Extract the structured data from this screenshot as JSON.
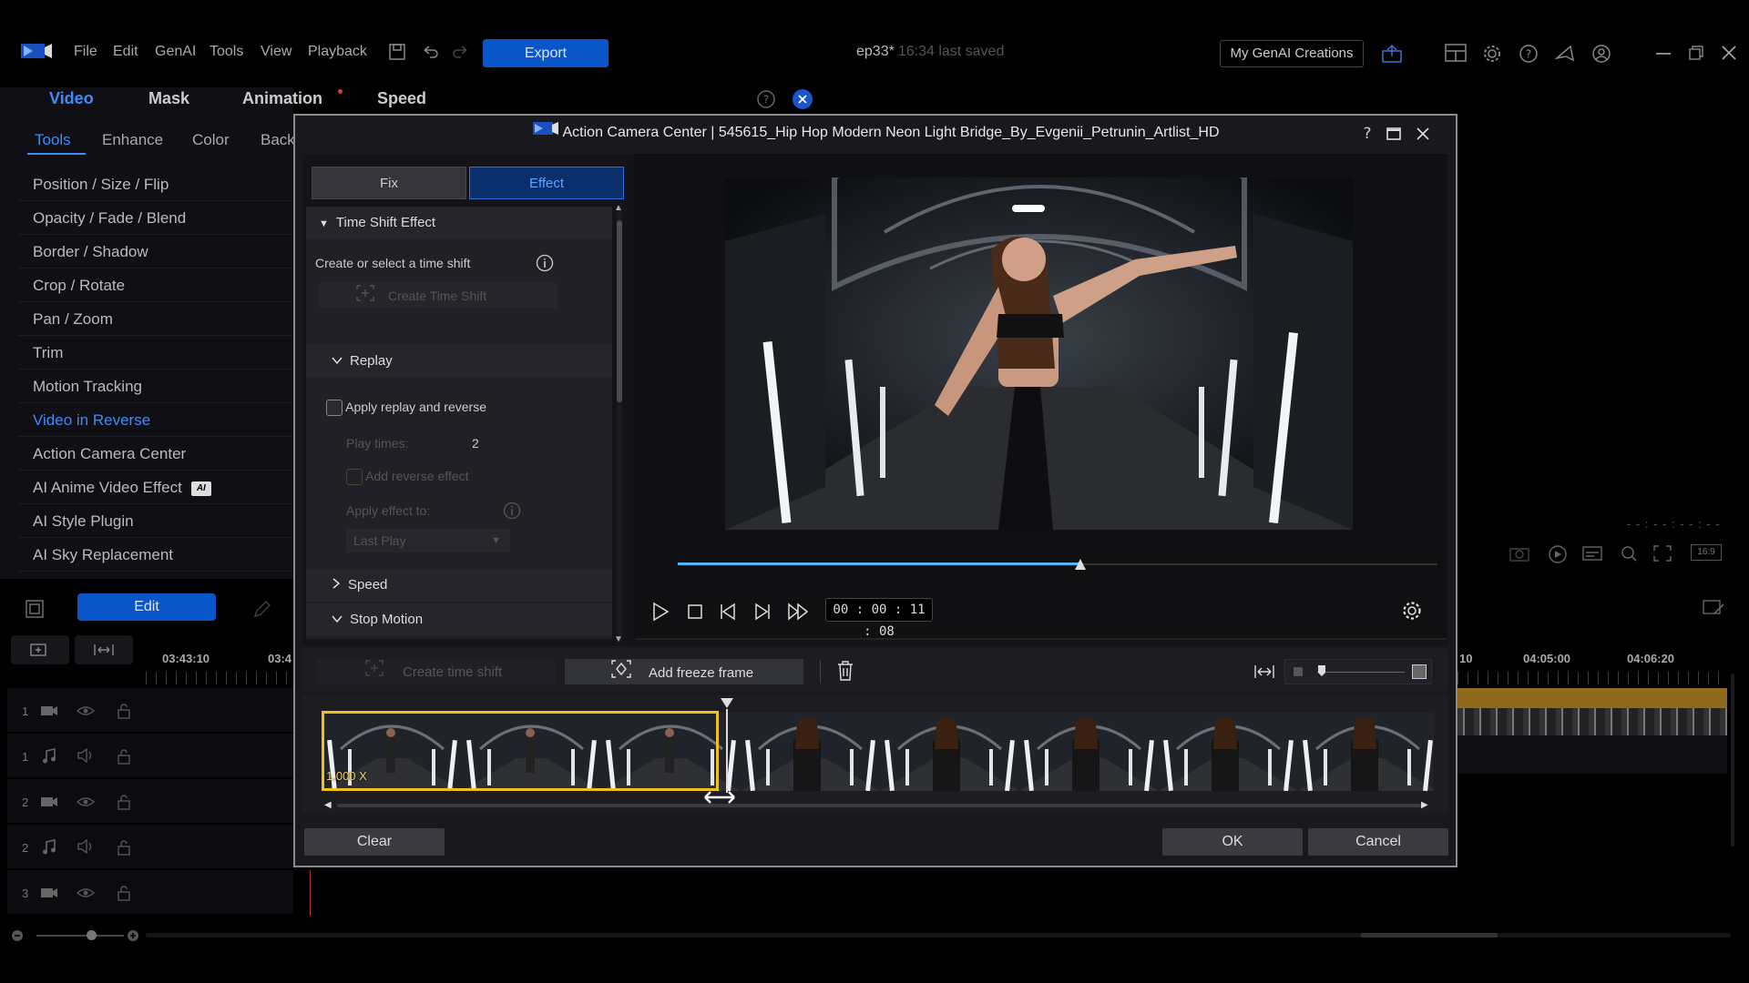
{
  "menu": [
    "File",
    "Edit",
    "GenAI",
    "Tools",
    "View",
    "Playback"
  ],
  "export_label": "Export",
  "project": {
    "name": "ep33*",
    "saved": "16:34 last saved"
  },
  "genai_btn": "My GenAI Creations",
  "main_tabs": [
    "Video",
    "Mask",
    "Animation",
    "Speed"
  ],
  "sub_tabs": [
    "Tools",
    "Enhance",
    "Color",
    "Back"
  ],
  "tools": [
    "Position / Size / Flip",
    "Opacity / Fade / Blend",
    "Border / Shadow",
    "Crop / Rotate",
    "Pan / Zoom",
    "Trim",
    "Motion Tracking",
    "Video in Reverse",
    "Action Camera Center",
    "AI Anime Video Effect",
    "AI Style Plugin",
    "AI Sky Replacement"
  ],
  "ai_badge": "AI",
  "edit_label": "Edit",
  "timeline_left": {
    "t1": "03:43:10",
    "t2": "03:4"
  },
  "timeline_right": {
    "t1": "10",
    "t2": "04:05:00",
    "t3": "04:06:20"
  },
  "track_nums": [
    "1",
    "1",
    "2",
    "2",
    "3"
  ],
  "aspect_label": "16:9",
  "dialog": {
    "title": "Action Camera Center  |  545615_Hip Hop Modern Neon Light Bridge_By_Evgenii_Petrunin_Artlist_HD",
    "tab_fix": "Fix",
    "tab_effect": "Effect",
    "time_shift_header": "Time Shift Effect",
    "create_or_select": "Create or select a time shift",
    "create_time_shift_disabled": "Create Time Shift",
    "replay_header": "Replay",
    "apply_replay": "Apply replay and reverse",
    "play_times_label": "Play times:",
    "play_times_value": "2",
    "add_reverse": "Add reverse effect",
    "apply_effect_to": "Apply effect to:",
    "last_play": "Last Play",
    "speed_header": "Speed",
    "stop_motion_header": "Stop Motion",
    "timecode": "00 : 00 : 11 : 08",
    "progress": 0.53,
    "create_time_shift": "Create time shift",
    "add_freeze_frame": "Add freeze frame",
    "speed_badge": "1.000 X",
    "clear": "Clear",
    "ok": "OK",
    "cancel": "Cancel"
  }
}
